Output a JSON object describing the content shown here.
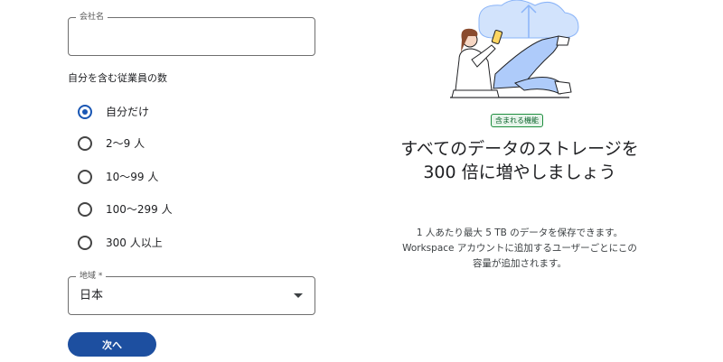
{
  "form": {
    "company": {
      "label": "会社名",
      "value": "",
      "placeholder": ""
    },
    "employees": {
      "label": "自分を含む従業員の数",
      "options": [
        {
          "label": "自分だけ",
          "selected": true
        },
        {
          "label": "2〜9 人",
          "selected": false
        },
        {
          "label": "10〜99 人",
          "selected": false
        },
        {
          "label": "100〜299 人",
          "selected": false
        },
        {
          "label": "300 人以上",
          "selected": false
        }
      ]
    },
    "region": {
      "label": "地域 *",
      "value": "日本"
    },
    "next_label": "次へ"
  },
  "promo": {
    "badge": "含まれる機能",
    "headline": "すべてのデータのストレージを 300 倍に増やしましょう",
    "description": "1 人あたり最大 5 TB のデータを保存できます。Workspace アカウントに追加するユーザーごとにこの容量が追加されます。"
  },
  "colors": {
    "primary": "#1d4fa0",
    "badge_green": "#1e8e3e",
    "badge_bg": "#e6f4ea",
    "cloud": "#d2e3fc"
  }
}
